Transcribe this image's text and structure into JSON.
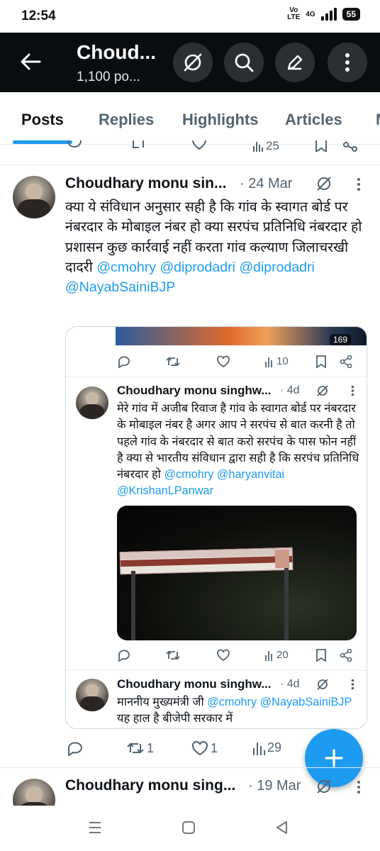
{
  "status_bar": {
    "time": "12:54",
    "volte": "Vo\nLTE",
    "network": "4G",
    "battery": "55"
  },
  "header": {
    "title": "Choud...",
    "subtitle": "1,100 po..."
  },
  "tabs": [
    {
      "label": "Posts",
      "active": true
    },
    {
      "label": "Replies"
    },
    {
      "label": "Highlights"
    },
    {
      "label": "Articles"
    },
    {
      "label": "M"
    }
  ],
  "top_action_row": {
    "views": "25"
  },
  "tweet1": {
    "name": "Choudhary monu sin...",
    "date": "· 24 Mar",
    "text": "क्या ये संविधान अनुसार सही है कि गांव के स्वागत बोर्ड पर नंबरदार के मोबाइल नंबर हो क्या सरपंच प्रतिनिधि नंबरदार हो प्रशासन कुछ कार्रवाई नहीं करता गांव कल्याण जिलाचरखी दादरी",
    "mentions": [
      "@cmohry",
      "@diprodadri",
      "@diprodadri",
      "@NayabSainiBJP"
    ],
    "actions": {
      "replies": "",
      "reposts": "1",
      "likes": "1",
      "views": "29"
    }
  },
  "quote": {
    "media_counter": "169",
    "top_actions": {
      "views": "10"
    },
    "reply1": {
      "name": "Choudhary monu singhw...",
      "date": "· 4d",
      "text": "मेरे गांव में अजीब रिवाज है गांव के स्वागत बोर्ड पर नंबरदार के मोबाइल नंबर है अगर आप ने सरपंच से बात करनी है तो पहले गांव के नंबरदार से बात करो सरपंच के पास फोन नहीं है क्या से भारतीय संविधान द्वारा सही है कि सरपंच प्रतिनिधि नंबरदार हो",
      "mentions": [
        "@cmohry",
        "@haryanvitai",
        "@KrishanLPanwar"
      ],
      "views": "20"
    },
    "reply2": {
      "name": "Choudhary monu singhw...",
      "date": "· 4d",
      "text_start": "माननीय मुख्यमंत्री जी",
      "mentions": [
        "@cmohry",
        "@NayabSainiBJP"
      ],
      "text_end": "यह हाल है बीजेपी सरकार में"
    }
  },
  "tweet2": {
    "name": "Choudhary monu sing...",
    "date": "· 19 Mar"
  },
  "colors": {
    "accent": "#1d9bf0",
    "header_bg": "#0a0d10",
    "text": "#0f1419",
    "muted": "#536471"
  }
}
